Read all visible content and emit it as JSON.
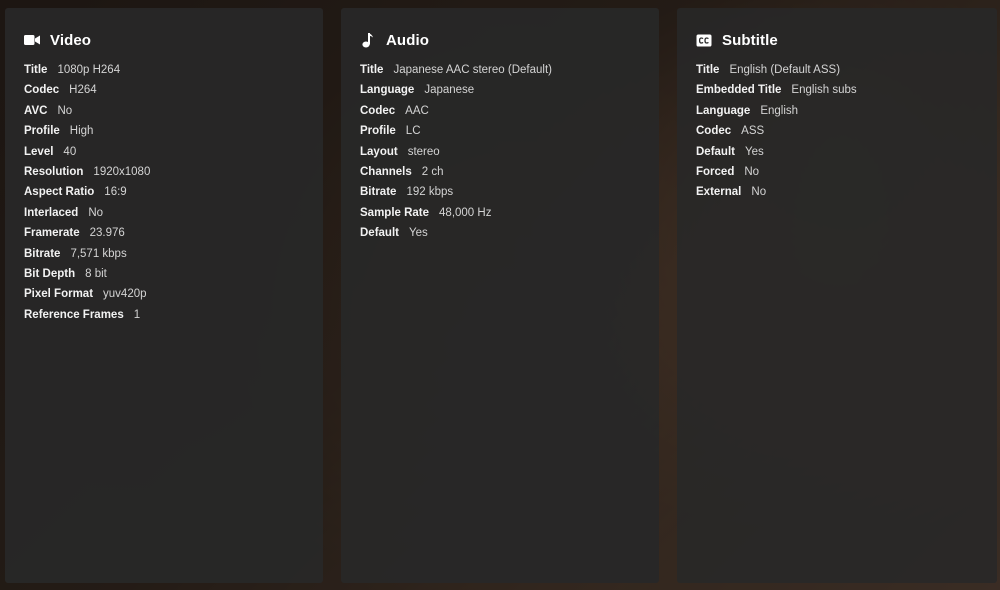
{
  "panels": {
    "video": {
      "title": "Video",
      "icon": "video-camera-icon",
      "rows": [
        {
          "key": "Title",
          "value": "1080p H264"
        },
        {
          "key": "Codec",
          "value": "H264"
        },
        {
          "key": "AVC",
          "value": "No"
        },
        {
          "key": "Profile",
          "value": "High"
        },
        {
          "key": "Level",
          "value": "40"
        },
        {
          "key": "Resolution",
          "value": "1920x1080"
        },
        {
          "key": "Aspect Ratio",
          "value": "16:9"
        },
        {
          "key": "Interlaced",
          "value": "No"
        },
        {
          "key": "Framerate",
          "value": "23.976"
        },
        {
          "key": "Bitrate",
          "value": "7,571 kbps"
        },
        {
          "key": "Bit Depth",
          "value": "8 bit"
        },
        {
          "key": "Pixel Format",
          "value": "yuv420p"
        },
        {
          "key": "Reference Frames",
          "value": "1"
        }
      ]
    },
    "audio": {
      "title": "Audio",
      "icon": "music-note-icon",
      "rows": [
        {
          "key": "Title",
          "value": "Japanese AAC stereo (Default)"
        },
        {
          "key": "Language",
          "value": "Japanese"
        },
        {
          "key": "Codec",
          "value": "AAC"
        },
        {
          "key": "Profile",
          "value": "LC"
        },
        {
          "key": "Layout",
          "value": "stereo"
        },
        {
          "key": "Channels",
          "value": "2 ch"
        },
        {
          "key": "Bitrate",
          "value": "192 kbps"
        },
        {
          "key": "Sample Rate",
          "value": "48,000 Hz"
        },
        {
          "key": "Default",
          "value": "Yes"
        }
      ]
    },
    "subtitle": {
      "title": "Subtitle",
      "icon": "closed-caption-icon",
      "rows": [
        {
          "key": "Title",
          "value": "English (Default ASS)"
        },
        {
          "key": "Embedded Title",
          "value": "English subs"
        },
        {
          "key": "Language",
          "value": "English"
        },
        {
          "key": "Codec",
          "value": "ASS"
        },
        {
          "key": "Default",
          "value": "Yes"
        },
        {
          "key": "Forced",
          "value": "No"
        },
        {
          "key": "External",
          "value": "No"
        }
      ]
    }
  },
  "colors": {
    "panel_bg": "#282828",
    "text_primary": "#ffffff",
    "text_secondary": "#d4d4d4"
  }
}
